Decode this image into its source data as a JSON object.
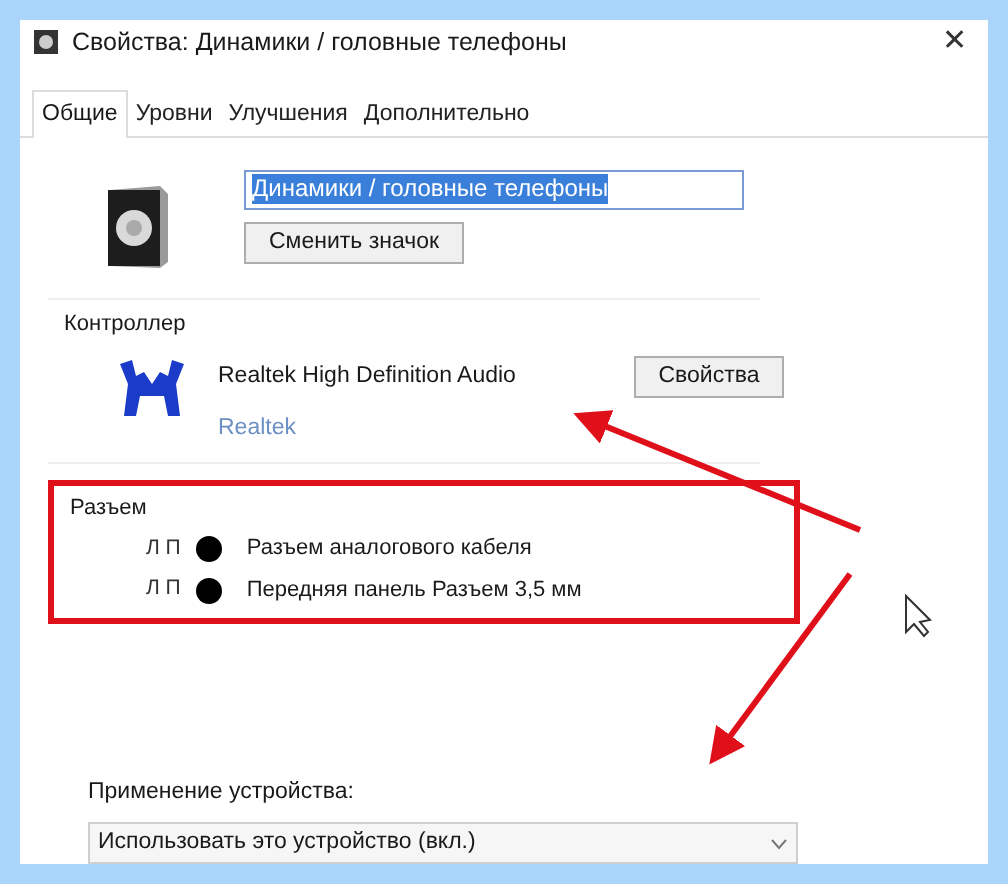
{
  "window": {
    "title": "Свойства: Динамики / головные телефоны",
    "close": "✕"
  },
  "tabs": [
    {
      "label": "Общие",
      "selected": true
    },
    {
      "label": "Уровни",
      "selected": false
    },
    {
      "label": "Улучшения",
      "selected": false
    },
    {
      "label": "Дополнительно",
      "selected": false
    }
  ],
  "device": {
    "name": "Динамики / головные телефоны",
    "name_selected": true,
    "change_icon_button": "Сменить значок"
  },
  "controller": {
    "heading": "Контроллер",
    "name": "Realtek High Definition Audio",
    "vendor_link": "Realtek",
    "properties_button": "Свойства"
  },
  "jacks": {
    "heading": "Разъем",
    "highlighted": true,
    "items": [
      {
        "channels": "Л П",
        "color": "#000000",
        "label": "Разъем аналогового кабеля"
      },
      {
        "channels": "Л П",
        "color": "#000000",
        "label": "Передняя панель Разъем 3,5 мм"
      }
    ]
  },
  "usage": {
    "label": "Применение устройства:",
    "value": "Использовать это устройство (вкл.)"
  }
}
